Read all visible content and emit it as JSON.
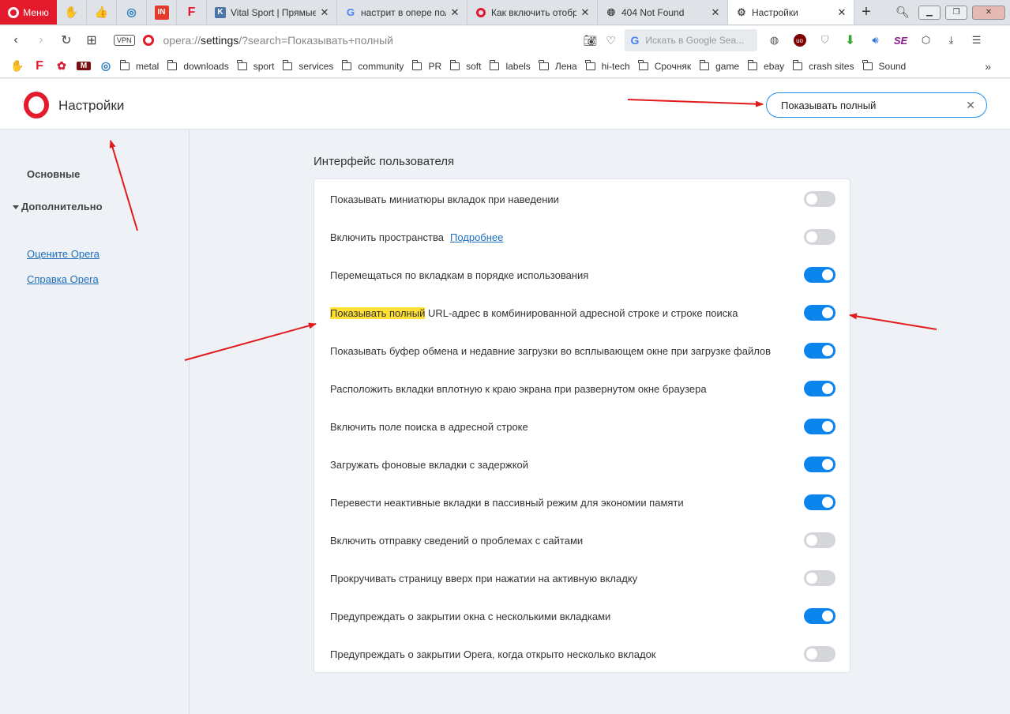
{
  "tabbar": {
    "menu_label": "Меню",
    "tabs": [
      {
        "title": "Vital Sport | Прямые т",
        "favicon": "vk-icon",
        "color": "#4a76a8"
      },
      {
        "title": "настрит в опере пол",
        "favicon": "google-icon",
        "color": "#4285f4"
      },
      {
        "title": "Как включить отобра",
        "favicon": "opera-icon",
        "color": "#e21a2c"
      },
      {
        "title": "404 Not Found",
        "favicon": "globe-icon",
        "color": "#555555"
      },
      {
        "title": "Настройки",
        "favicon": "gear-icon",
        "color": "#555555",
        "active": true
      }
    ]
  },
  "addressbar": {
    "vpn_label": "VPN",
    "url_prefix": "opera://",
    "url_host": "settings",
    "url_rest": "/?search=Показывать+полный",
    "google_placeholder": "Искать в Google Sea..."
  },
  "bookmarks": [
    "metal",
    "downloads",
    "sport",
    "services",
    "community",
    "PR",
    "soft",
    "labels",
    "Лена",
    "hi-tech",
    "Срочняк",
    "game",
    "ebay",
    "crash sites",
    "Sound"
  ],
  "settings": {
    "title": "Настройки",
    "search_value": "Показывать полный"
  },
  "sidebar": {
    "basic": "Основные",
    "advanced": "Дополнительно",
    "rate": "Оцените Opera",
    "help": "Справка Opera"
  },
  "main": {
    "section_title": "Интерфейс пользователя",
    "rows": [
      {
        "label": "Показывать миниатюры вкладок при наведении",
        "on": false
      },
      {
        "label": "Включить пространства",
        "more": "Подробнее",
        "on": false
      },
      {
        "label": "Перемещаться по вкладкам в порядке использования",
        "on": true
      },
      {
        "label_highlight": "Показывать полный",
        "label_rest": " URL-адрес в комбинированной адресной строке и строке поиска",
        "on": true
      },
      {
        "label": "Показывать буфер обмена и недавние загрузки во всплывающем окне при загрузке файлов",
        "on": true
      },
      {
        "label": "Расположить вкладки вплотную к краю экрана при развернутом окне браузера",
        "on": true
      },
      {
        "label": "Включить поле поиска в адресной строке",
        "on": true
      },
      {
        "label": "Загружать фоновые вкладки с задержкой",
        "on": true
      },
      {
        "label": "Перевести неактивные вкладки в пассивный режим для экономии памяти",
        "on": true
      },
      {
        "label": "Включить отправку сведений о проблемах с сайтами",
        "on": false
      },
      {
        "label": "Прокручивать страницу вверх при нажатии на активную вкладку",
        "on": false
      },
      {
        "label": "Предупреждать о закрытии окна с несколькими вкладками",
        "on": true
      },
      {
        "label": "Предупреждать о закрытии Opera, когда открыто несколько вкладок",
        "on": false
      }
    ]
  },
  "colors": {
    "accent": "#0b84f0",
    "opera_red": "#e21a2c",
    "highlight": "#ffe135",
    "arrow": "#e11b1b"
  }
}
